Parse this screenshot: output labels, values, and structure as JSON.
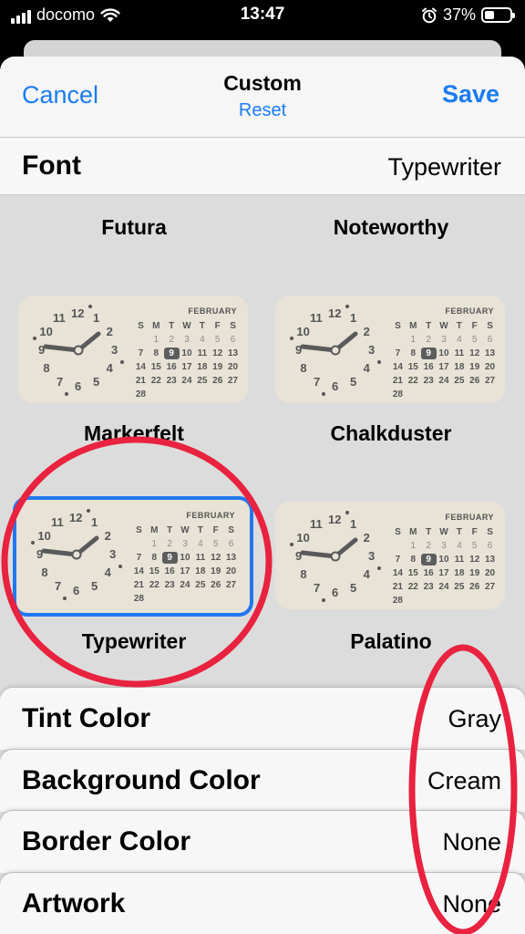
{
  "status_bar": {
    "carrier": "docomo",
    "time": "13:47",
    "battery": "37%",
    "battery_level": 0.37
  },
  "nav": {
    "cancel_label": "Cancel",
    "title": "Custom",
    "reset_label": "Reset",
    "save_label": "Save"
  },
  "font_setting": {
    "label": "Font",
    "value": "Typewriter"
  },
  "fonts": [
    {
      "name": "Futura",
      "preview": false
    },
    {
      "name": "Noteworthy",
      "preview": false
    },
    {
      "name": "Markerfelt",
      "preview": true,
      "selected": false
    },
    {
      "name": "Chalkduster",
      "preview": true,
      "selected": false
    },
    {
      "name": "Typewriter",
      "preview": true,
      "selected": true
    },
    {
      "name": "Palatino",
      "preview": true,
      "selected": false
    }
  ],
  "preview": {
    "month": "FEBRUARY",
    "weekdays": [
      "S",
      "M",
      "T",
      "W",
      "T",
      "F",
      "S"
    ],
    "days": [
      "",
      "1",
      "2",
      "3",
      "4",
      "5",
      "6",
      "7",
      "8",
      "9",
      "10",
      "11",
      "12",
      "13",
      "14",
      "15",
      "16",
      "17",
      "18",
      "19",
      "20",
      "21",
      "22",
      "23",
      "24",
      "25",
      "26",
      "27",
      "28"
    ],
    "today": "9",
    "clock_numbers": [
      "12",
      "1",
      "2",
      "3",
      "4",
      "5",
      "6",
      "7",
      "8",
      "9",
      "10",
      "11"
    ]
  },
  "settings": [
    {
      "label": "Tint Color",
      "value": "Gray"
    },
    {
      "label": "Background Color",
      "value": "Cream"
    },
    {
      "label": "Border Color",
      "value": "None"
    },
    {
      "label": "Artwork",
      "value": "None"
    }
  ],
  "colors": {
    "accent": "#1a7cf0",
    "selection_border": "#2377f0",
    "annotation": "#e8223f",
    "widget_bg": "#e8e3d6"
  }
}
